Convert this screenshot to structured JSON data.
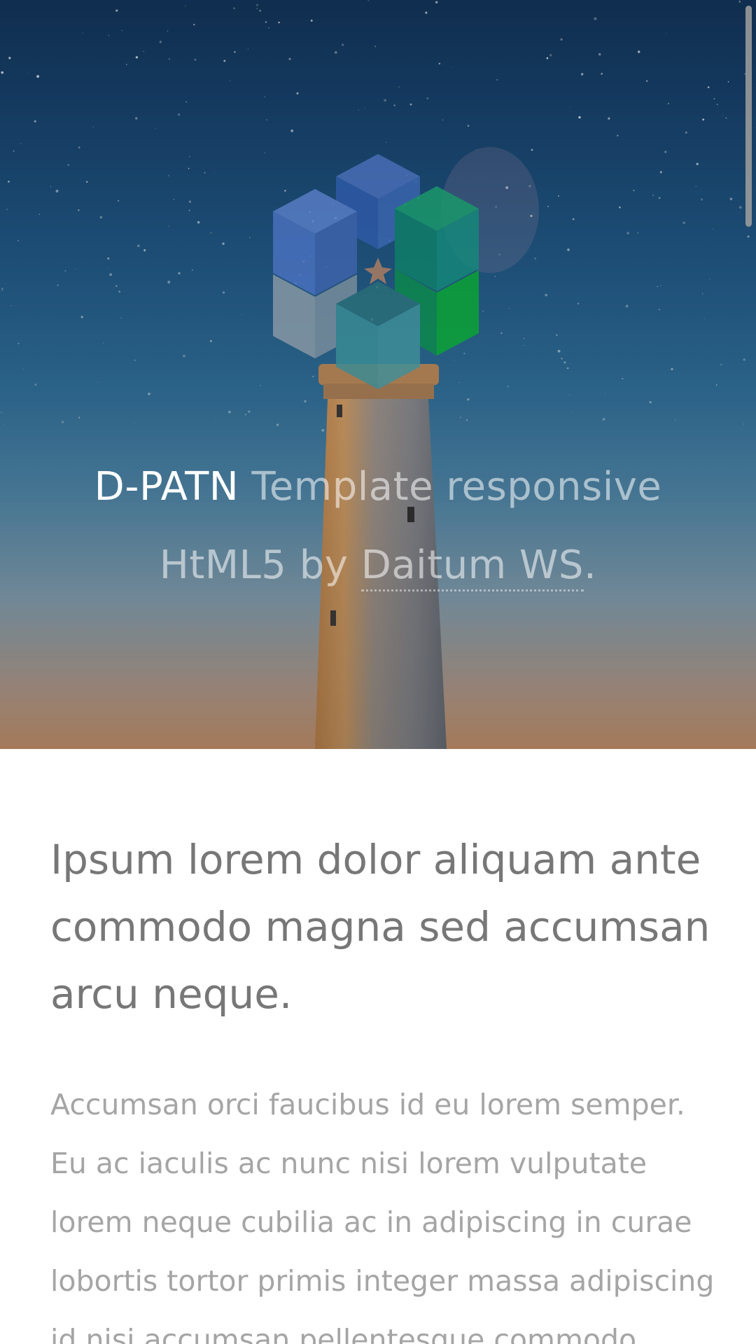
{
  "hero": {
    "brand": "D-PATN",
    "title_part1": "Template responsive",
    "title_part2": "HtML5 by",
    "link_text": "Daitum WS",
    "title_end": "."
  },
  "main": {
    "headline": "Ipsum lorem dolor aliquam ante commodo magna sed accumsan arcu neque.",
    "paragraph": "Accumsan orci faucibus id eu lorem semper. Eu ac iaculis ac nunc nisi lorem vulputate lorem neque cubilia ac in adipiscing in curae lobortis tortor primis integer massa adipiscing id nisi accumsan pellentesque commodo"
  },
  "icons": {
    "logo": "cube-cluster-logo-icon"
  },
  "colors": {
    "sky_top": "#0f2f52",
    "sky_bottom": "#b8855f",
    "headline": "#777777",
    "paragraph": "#a5a5a5"
  }
}
